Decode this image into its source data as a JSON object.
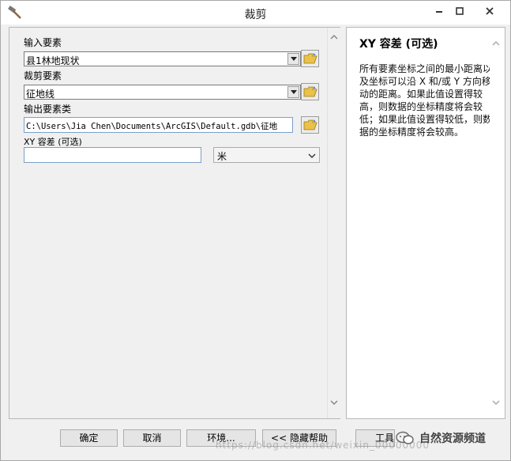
{
  "window": {
    "title": "裁剪"
  },
  "fields": {
    "input_label": "输入要素",
    "input_value": "县1林地现状",
    "clip_label": "裁剪要素",
    "clip_value": "征地线",
    "output_label": "输出要素类",
    "output_value": "C:\\Users\\Jia Chen\\Documents\\ArcGIS\\Default.gdb\\征地",
    "xy_label": "XY 容差 (可选)",
    "xy_value": "",
    "unit_value": "米"
  },
  "help": {
    "title": "XY 容差 (可选)",
    "body": "所有要素坐标之间的最小距离以及坐标可以沿 X 和/或 Y 方向移动的距离。如果此值设置得较高，则数据的坐标精度将会较低；如果此值设置得较低，则数据的坐标精度将会较高。"
  },
  "buttons": {
    "ok": "确定",
    "cancel": "取消",
    "env": "环境...",
    "hide_help": "<< 隐藏帮助",
    "tool_help": "工具"
  },
  "watermark": {
    "url": "https://blog.csdn.net/weixin_00000000",
    "brand": "自然资源频道"
  }
}
